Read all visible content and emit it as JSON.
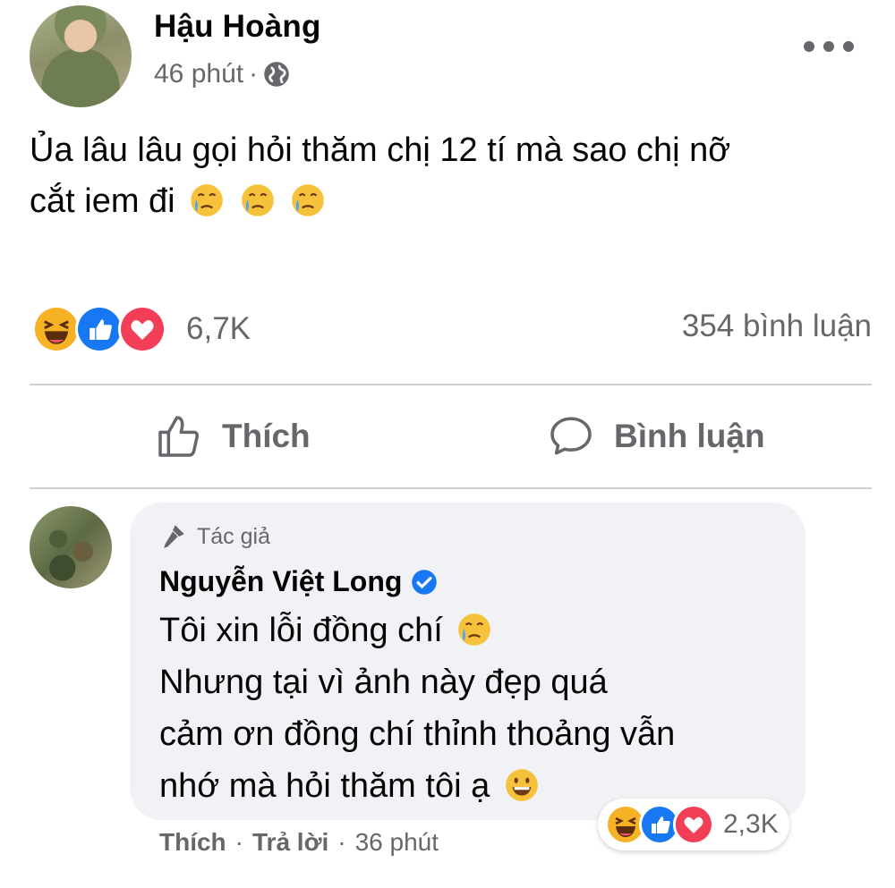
{
  "post": {
    "author": "Hậu Hoàng",
    "time": "46 phút",
    "separator": "·",
    "text_line1": "Ủa lâu lâu gọi hỏi thăm chị 12 tí mà sao chị nỡ",
    "text_line2": "cắt iem đi",
    "reaction_count": "6,7K",
    "comment_count": "354 bình luận",
    "icons": [
      "globe-icon",
      "more-icon",
      "crying-face-emoji"
    ]
  },
  "actions": {
    "like_label": "Thích",
    "comment_label": "Bình luận"
  },
  "comment": {
    "badge": "Tác giả",
    "author": "Nguyễn Việt Long",
    "lines": [
      "Tôi xin lỗi đồng chí",
      "Nhưng tại vì ảnh này đẹp quá",
      "cảm ơn đồng chí thỉnh thoảng vẫn",
      "nhớ mà hỏi thăm tôi ạ"
    ],
    "reaction_count": "2,3K",
    "like_label": "Thích",
    "reply_label": "Trả lời",
    "separator": "·",
    "time": "36 phút"
  },
  "colors": {
    "text_primary": "#050505",
    "text_secondary": "#65676b",
    "like_blue": "#1877f2",
    "love_red": "#f33e58",
    "haha_yellow": "#f7b125",
    "bubble_bg": "#f0f2f5"
  }
}
